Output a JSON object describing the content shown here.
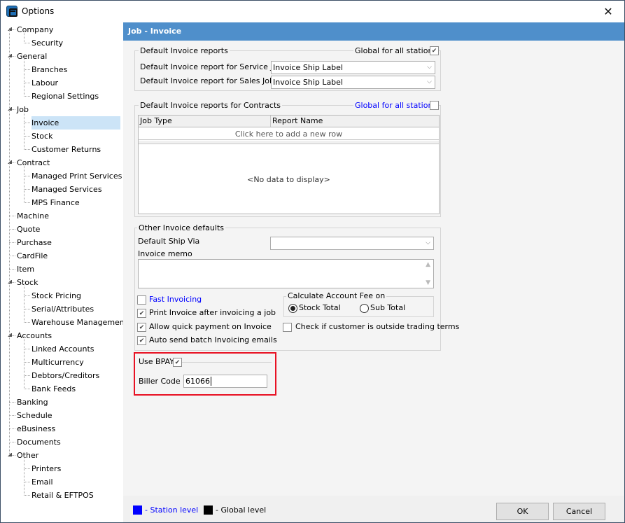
{
  "window": {
    "title": "Options",
    "close_glyph": "✕"
  },
  "tree": {
    "items": [
      {
        "label": "Company",
        "level": 0,
        "expanded": true
      },
      {
        "label": "Security",
        "level": 1
      },
      {
        "label": "General",
        "level": 0,
        "expanded": true
      },
      {
        "label": "Branches",
        "level": 1
      },
      {
        "label": "Labour",
        "level": 1
      },
      {
        "label": "Regional Settings",
        "level": 1
      },
      {
        "label": "Job",
        "level": 0,
        "expanded": true
      },
      {
        "label": "Invoice",
        "level": 1,
        "selected": true
      },
      {
        "label": "Stock",
        "level": 1
      },
      {
        "label": "Customer Returns",
        "level": 1
      },
      {
        "label": "Contract",
        "level": 0,
        "expanded": true
      },
      {
        "label": "Managed Print Services",
        "level": 1
      },
      {
        "label": "Managed Services",
        "level": 1
      },
      {
        "label": "MPS Finance",
        "level": 1
      },
      {
        "label": "Machine",
        "level": 0
      },
      {
        "label": "Quote",
        "level": 0
      },
      {
        "label": "Purchase",
        "level": 0
      },
      {
        "label": "CardFile",
        "level": 0
      },
      {
        "label": "Item",
        "level": 0
      },
      {
        "label": "Stock",
        "level": 0,
        "expanded": true
      },
      {
        "label": "Stock Pricing",
        "level": 1
      },
      {
        "label": "Serial/Attributes",
        "level": 1
      },
      {
        "label": "Warehouse Management",
        "level": 1
      },
      {
        "label": "Accounts",
        "level": 0,
        "expanded": true
      },
      {
        "label": "Linked Accounts",
        "level": 1
      },
      {
        "label": "Multicurrency",
        "level": 1
      },
      {
        "label": "Debtors/Creditors",
        "level": 1
      },
      {
        "label": "Bank Feeds",
        "level": 1
      },
      {
        "label": "Banking",
        "level": 0
      },
      {
        "label": "Schedule",
        "level": 0
      },
      {
        "label": "eBusiness",
        "level": 0
      },
      {
        "label": "Documents",
        "level": 0
      },
      {
        "label": "Other",
        "level": 0,
        "expanded": true
      },
      {
        "label": "Printers",
        "level": 1
      },
      {
        "label": "Email",
        "level": 1
      },
      {
        "label": "Retail & EFTPOS",
        "level": 1
      }
    ]
  },
  "main": {
    "header": "Job - Invoice",
    "default_reports": {
      "legend": "Default Invoice reports",
      "global_label": "Global for all stations",
      "global_checked": true,
      "service_label": "Default Invoice report for Service Job",
      "service_value": "Invoice Ship Label",
      "sales_label": "Default Invoice report for Sales Job",
      "sales_value": "Invoice Ship Label"
    },
    "contracts": {
      "legend": "Default Invoice reports for Contracts",
      "global_label": "Global for all stations",
      "global_checked": false,
      "columns": [
        "Job Type",
        "Report Name"
      ],
      "new_row_text": "Click here to add a new row",
      "empty_text": "<No data to display>"
    },
    "other": {
      "legend": "Other Invoice defaults",
      "ship_via_label": "Default Ship Via",
      "ship_via_value": "",
      "memo_label": "Invoice memo",
      "memo_value": "",
      "checkboxes": [
        {
          "label": "Fast Invoicing",
          "checked": false,
          "station_level": true
        },
        {
          "label": "Print Invoice after invoicing a job",
          "checked": true
        },
        {
          "label": "Allow quick payment on Invoice",
          "checked": true
        },
        {
          "label": "Auto send batch Invoicing emails",
          "checked": true
        }
      ],
      "account_fee": {
        "legend": "Calculate Account Fee on",
        "options": [
          "Stock Total",
          "Sub Total"
        ],
        "selected": "Stock Total"
      },
      "trading_terms_label": "Check if customer is outside trading terms",
      "trading_terms_checked": false
    },
    "bpay": {
      "label": "Use BPAY",
      "checked": true,
      "biller_code_label": "Biller Code",
      "biller_code_value": "61066"
    }
  },
  "footer": {
    "station_level": "- Station level",
    "global_level": "- Global level",
    "station_color": "#0000ff",
    "global_color": "#000000",
    "ok": "OK",
    "cancel": "Cancel"
  },
  "colors": {
    "header_bg": "#4f8fcb",
    "selection_bg": "#cce4f7",
    "highlight_border": "#e81123",
    "station_text": "#0000ff"
  }
}
